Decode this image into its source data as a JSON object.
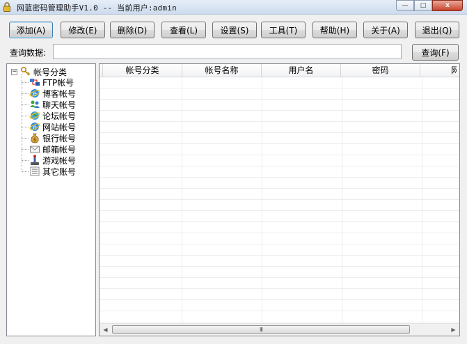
{
  "window": {
    "title": "网蓝密码管理助手V1.0 -- 当前用户:admin",
    "minimize": "—",
    "maximize": "□",
    "close": "x"
  },
  "toolbar": {
    "buttons": [
      {
        "label": "添加(A)",
        "active": true
      },
      {
        "label": "修改(E)"
      },
      {
        "label": "删除(D)"
      },
      {
        "label": "查看(L)"
      },
      {
        "label": "设置(S)"
      },
      {
        "label": "工具(T)"
      },
      {
        "label": "帮助(H)"
      },
      {
        "label": "关于(A)"
      },
      {
        "label": "退出(Q)"
      }
    ]
  },
  "search": {
    "label": "查询数据:",
    "value": "",
    "button": "查询(F)"
  },
  "tree": {
    "root": "帐号分类",
    "expander": "−",
    "items": [
      {
        "label": "FTP帐号",
        "icon": "ftp-icon"
      },
      {
        "label": "博客帐号",
        "icon": "ie-icon"
      },
      {
        "label": "聊天帐号",
        "icon": "chat-users-icon"
      },
      {
        "label": "论坛帐号",
        "icon": "forum-globe-icon"
      },
      {
        "label": "网站帐号",
        "icon": "ie-icon"
      },
      {
        "label": "银行帐号",
        "icon": "money-bag-icon"
      },
      {
        "label": "邮箱帐号",
        "icon": "mail-icon"
      },
      {
        "label": "游戏帐号",
        "icon": "joystick-icon"
      },
      {
        "label": "其它账号",
        "icon": "list-icon"
      }
    ]
  },
  "grid": {
    "columns": [
      "帐号分类",
      "帐号名称",
      "用户名",
      "密码",
      "网"
    ],
    "rows": [],
    "scroll_thumb": "III"
  },
  "colors": {
    "accent": "#3c7fb1",
    "border": "#828790",
    "close": "#c8432b"
  }
}
